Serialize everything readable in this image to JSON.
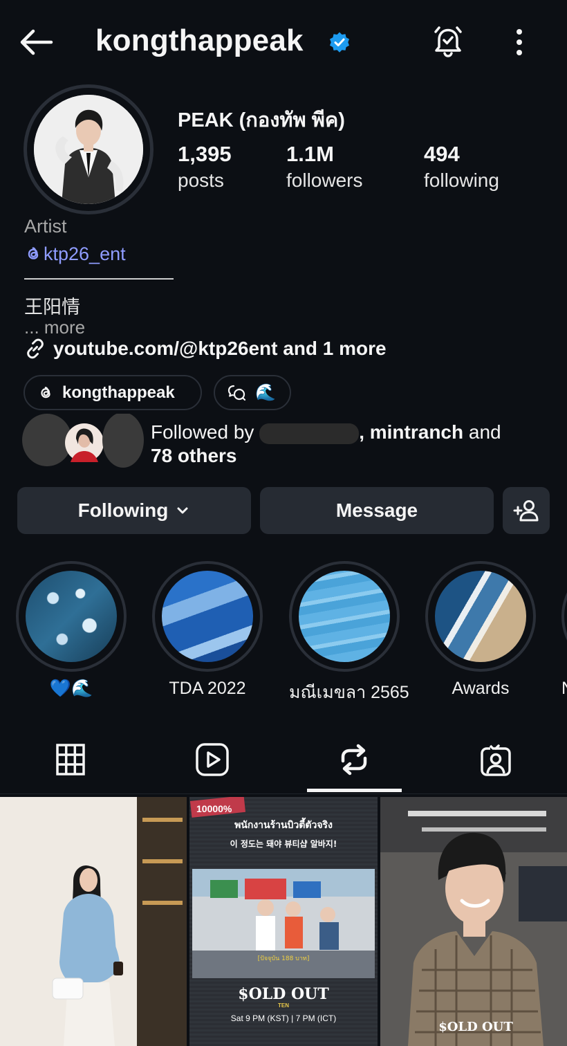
{
  "header": {
    "username": "kongthappeak",
    "verified": true,
    "back_icon": "arrow-left-icon",
    "bell_icon": "bell-check-icon",
    "more_icon": "more-vertical-icon"
  },
  "profile": {
    "display_name": "PEAK (กองทัพ พีค)",
    "stats": [
      {
        "value": "1,395",
        "label": "posts"
      },
      {
        "value": "1.1M",
        "label": "followers"
      },
      {
        "value": "494",
        "label": "following"
      }
    ]
  },
  "bio": {
    "category": "Artist",
    "handle": "ktp26_ent",
    "divider": "————————",
    "text": "王阳情",
    "more": "... more",
    "link": "youtube.com/@ktp26ent and 1 more"
  },
  "chips": {
    "threads_label": "kongthappeak",
    "threads_icon": "threads-icon",
    "chat_icon": "chat-bubbles-icon",
    "chat_emoji": "🌊"
  },
  "followed_by": {
    "prefix": "Followed by ",
    "names": ", mintranch",
    "and": " and",
    "others": "78 others"
  },
  "actions": {
    "following_label": "Following",
    "message_label": "Message",
    "add_user_icon": "person-add-icon"
  },
  "highlights": [
    {
      "label": "💙🌊"
    },
    {
      "label": "TDA 2022"
    },
    {
      "label": "มณีเมขลา 2565"
    },
    {
      "label": "Awards"
    },
    {
      "label": "N"
    }
  ],
  "tabs": [
    {
      "icon": "grid-icon"
    },
    {
      "icon": "reels-icon"
    },
    {
      "icon": "reposts-icon",
      "active": true
    },
    {
      "icon": "tagged-icon"
    }
  ],
  "posts": [
    {
      "alt": "Woman in denim shirt holding coffee"
    },
    {
      "headline_th": "พนักงานร้านบิวตี้ตัวจริง",
      "headline_ko": "이 정도는 돼야 뷰티샵 알바지!",
      "tag": "10000%",
      "price": "[ปัจจุบัน 188 บาท]",
      "brand": "$OLD OUT",
      "brand_sub": "TEN",
      "schedule": "Sat 9 PM (KST) | 7 PM (ICT)"
    },
    {
      "brand": "$OLD OUT"
    }
  ],
  "colors": {
    "background": "#0c0f14",
    "button": "#262b33",
    "link": "#8f9cff",
    "verified": "#1d9bf0"
  }
}
